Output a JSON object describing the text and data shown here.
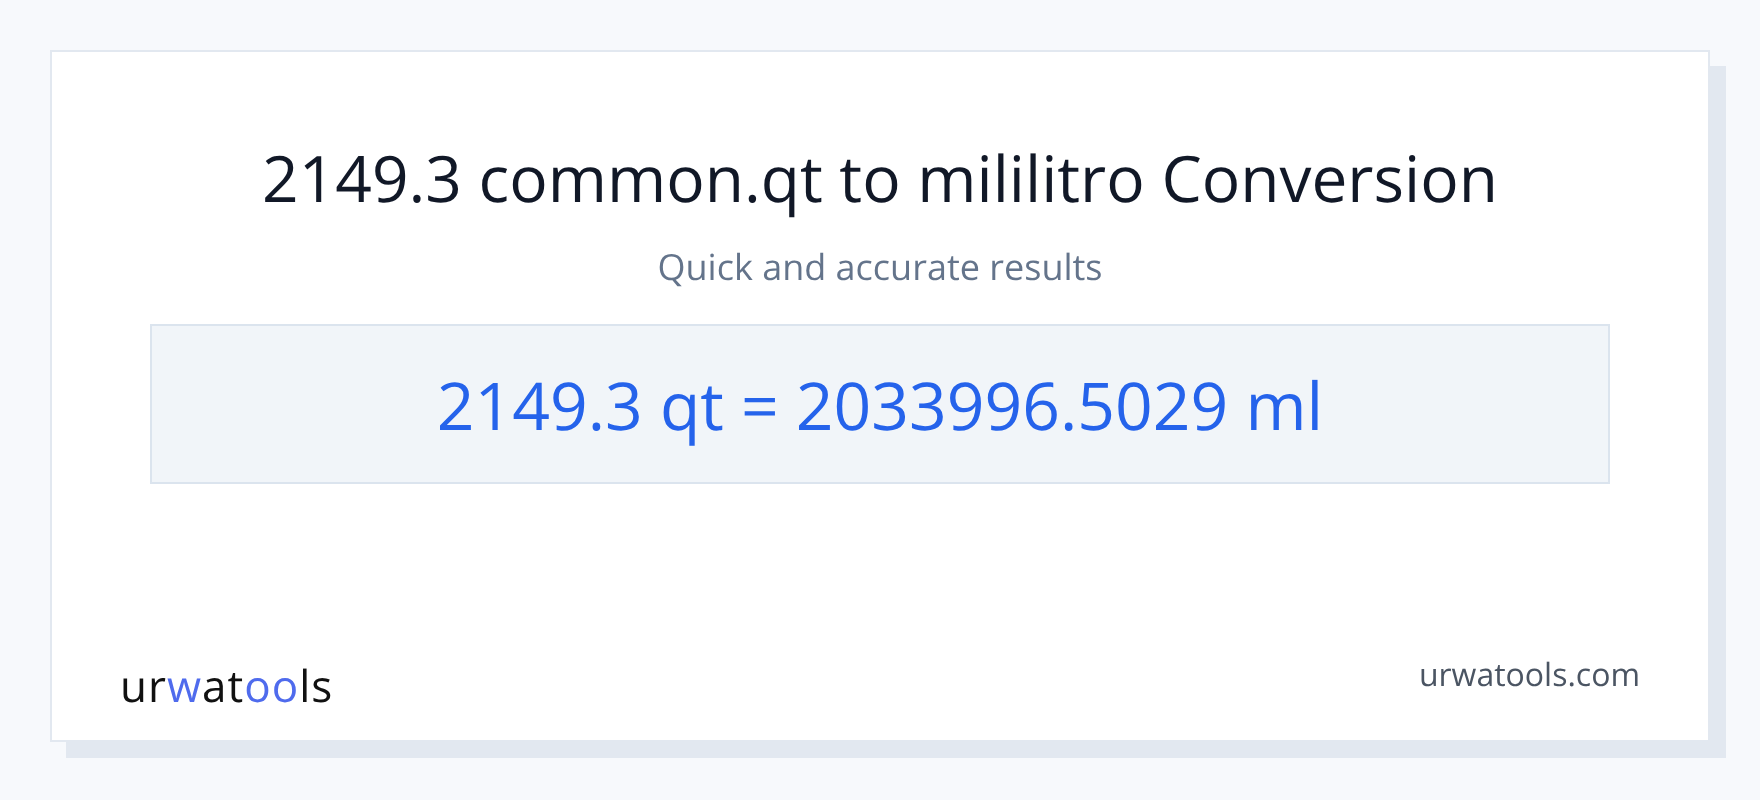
{
  "title": "2149.3 common.qt to mililitro Conversion",
  "subtitle": "Quick and accurate results",
  "result": "2149.3 qt = 2033996.5029 ml",
  "logo": [
    {
      "text": "ur",
      "accent": false
    },
    {
      "text": "w",
      "accent": true
    },
    {
      "text": "at",
      "accent": false
    },
    {
      "text": "oo",
      "accent": true
    },
    {
      "text": "ls",
      "accent": false
    }
  ],
  "site": "urwatools.com"
}
